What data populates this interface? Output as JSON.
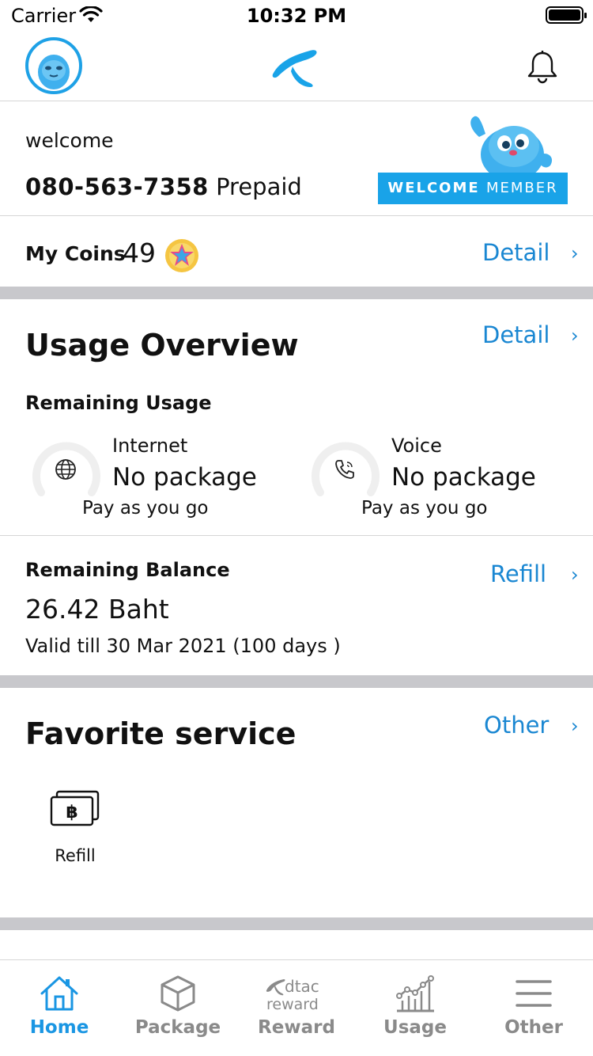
{
  "status_bar": {
    "carrier": "Carrier",
    "time": "10:32 PM"
  },
  "header": {
    "avatar_icon": "mascot-avatar-icon",
    "logo_icon": "dtac-logo-icon",
    "notification_icon": "bell-icon"
  },
  "welcome": {
    "greeting": "welcome",
    "phone_number": "080-563-7358",
    "plan_type": "Prepaid",
    "badge_strong": "WELCOME",
    "badge_light": "MEMBER"
  },
  "coins": {
    "label": "My Coins",
    "value": "49",
    "detail_label": "Detail"
  },
  "usage_overview": {
    "title": "Usage Overview",
    "detail_label": "Detail",
    "subtitle": "Remaining Usage",
    "items": [
      {
        "name": "Internet",
        "value": "No package",
        "note": "Pay as you go",
        "icon": "globe-icon"
      },
      {
        "name": "Voice",
        "value": "No package",
        "note": "Pay as you go",
        "icon": "phone-call-icon"
      }
    ]
  },
  "balance": {
    "title": "Remaining Balance",
    "action_label": "Refill",
    "amount": "26.42 Baht",
    "valid_text": "Valid till 30 Mar 2021 (100 days )"
  },
  "favorite": {
    "title": "Favorite service",
    "action_label": "Other",
    "items": [
      {
        "label": "Refill",
        "icon": "baht-wallet-icon"
      }
    ]
  },
  "bottom_nav": {
    "items": [
      {
        "label": "Home",
        "icon": "home-icon",
        "active": true
      },
      {
        "label": "Package",
        "icon": "box-icon",
        "active": false
      },
      {
        "label": "Reward",
        "icon": "dtac-reward-icon",
        "logo_text_top": "dtac",
        "logo_text_bottom": "reward",
        "active": false
      },
      {
        "label": "Usage",
        "icon": "chart-icon",
        "active": false
      },
      {
        "label": "Other",
        "icon": "menu-icon",
        "active": false
      }
    ]
  },
  "colors": {
    "accent": "#1a87d2",
    "brand_blue": "#19a3e8",
    "active_nav": "#1a96e3",
    "section_gap": "#c8c8cc"
  }
}
